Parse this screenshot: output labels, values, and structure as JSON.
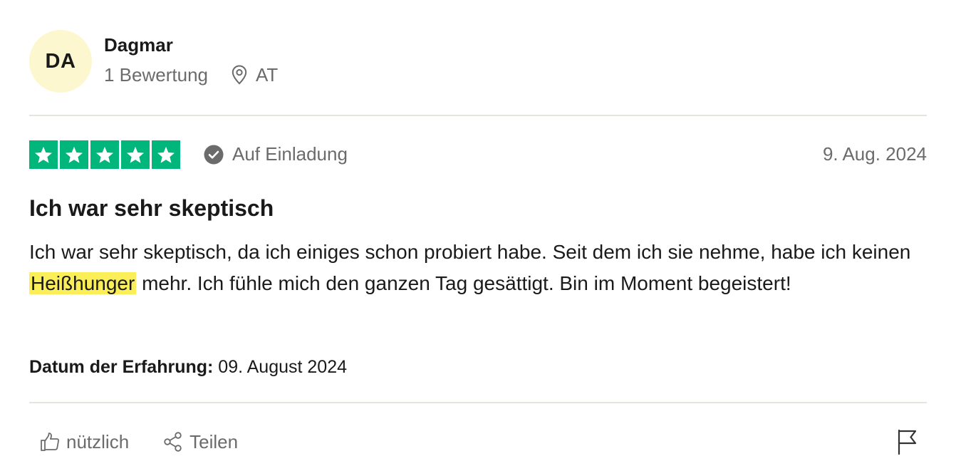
{
  "consumer": {
    "initials": "DA",
    "name": "Dagmar",
    "reviews_count": "1 Bewertung",
    "country": "AT",
    "avatar_color": "#fcf7cf"
  },
  "review": {
    "rating": 5,
    "star_color": "#00b67a",
    "verification_label": "Auf Einladung",
    "date": "9. Aug. 2024",
    "title": "Ich war sehr skeptisch",
    "body_before": "Ich war sehr skeptisch, da ich einiges schon probiert habe. Seit dem ich sie nehme, habe ich keinen ",
    "body_highlight": "Heißhunger",
    "body_after": " mehr. Ich fühle mich den ganzen Tag gesättigt. Bin im Moment begeistert!",
    "highlight_color": "#fbef59",
    "experience_label": "Datum der Erfahrung:",
    "experience_date": " 09. August 2024"
  },
  "actions": {
    "useful_label": "nützlich",
    "share_label": "Teilen"
  },
  "icons": {
    "location": "location-pin-icon",
    "verified": "check-circle-icon",
    "useful": "thumbs-up-icon",
    "share": "share-icon",
    "report": "flag-icon",
    "star": "star-icon"
  }
}
